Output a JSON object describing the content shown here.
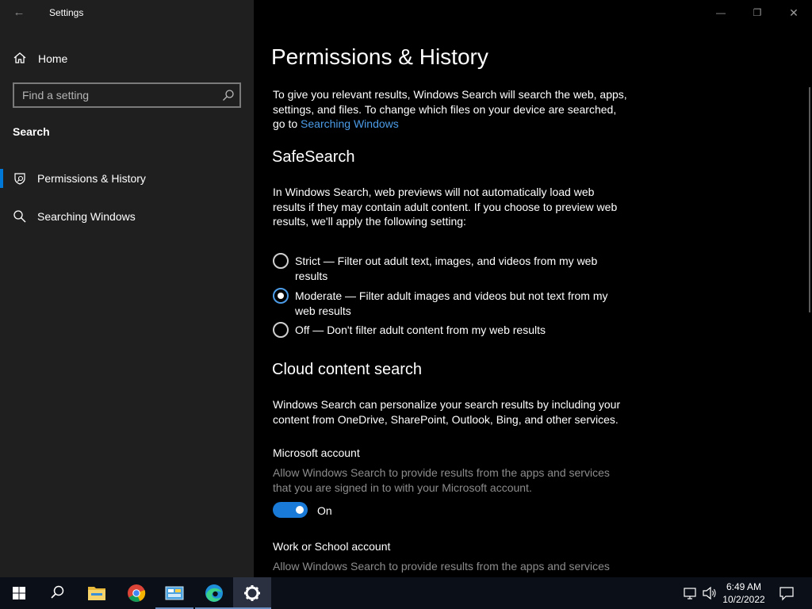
{
  "window": {
    "app_title": "Settings",
    "back_glyph": "←",
    "minimize_glyph": "—",
    "maximize_glyph": "❐",
    "close_glyph": "✕"
  },
  "sidebar": {
    "home_label": "Home",
    "search_placeholder": "Find a setting",
    "section_title": "Search",
    "items": [
      {
        "label": "Permissions & History",
        "icon": "shield-search-icon",
        "selected": true
      },
      {
        "label": "Searching Windows",
        "icon": "search-icon",
        "selected": false
      }
    ]
  },
  "main": {
    "title": "Permissions & History",
    "intro_text": "To give you relevant results, Windows Search will search the web, apps, settings, and files. To change which files on your device are searched, go to ",
    "intro_link": "Searching Windows",
    "safesearch": {
      "heading": "SafeSearch",
      "description": "In Windows Search, web previews will not automatically load web results if they may contain adult content. If you choose to preview web results, we'll apply the following setting:",
      "options": [
        {
          "label": "Strict — Filter out adult text, images, and videos from my web results",
          "checked": false
        },
        {
          "label": "Moderate — Filter adult images and videos but not text from my web results",
          "checked": true
        },
        {
          "label": "Off — Don't filter adult content from my web results",
          "checked": false
        }
      ]
    },
    "cloud": {
      "heading": "Cloud content search",
      "description": "Windows Search can personalize your search results by including your content from OneDrive, SharePoint, Outlook, Bing, and other services.",
      "microsoft_account": {
        "heading": "Microsoft account",
        "description": "Allow Windows Search to provide results from the apps and services that you are signed in to with your Microsoft account.",
        "toggle_state": "On"
      },
      "work_account": {
        "heading": "Work or School account",
        "description": "Allow Windows Search to provide results from the apps and services"
      }
    }
  },
  "taskbar": {
    "time": "6:49 AM",
    "date": "10/2/2022",
    "accent": "#0078d7"
  }
}
